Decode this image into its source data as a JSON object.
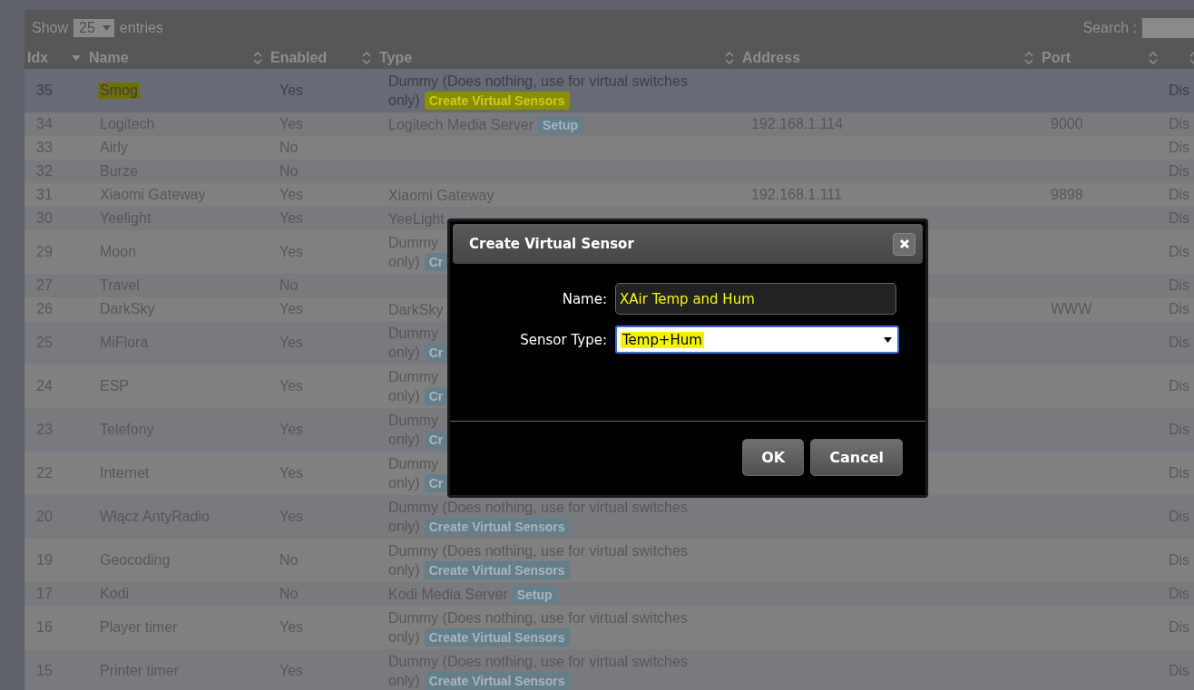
{
  "toolbar": {
    "show_label": "Show",
    "page_size": "25",
    "entries_label": "entries",
    "search_label": "Search :"
  },
  "table": {
    "columns": [
      {
        "label": "Idx",
        "kind": "sorted"
      },
      {
        "label": "Name",
        "kind": "sortable"
      },
      {
        "label": "Enabled",
        "kind": "sortable"
      },
      {
        "label": "Type",
        "kind": "sortable"
      },
      {
        "label": "Address",
        "kind": "sortable"
      },
      {
        "label": "Port",
        "kind": "sortable"
      },
      {
        "kind": "sortable"
      }
    ],
    "rows": [
      {
        "idx": "35",
        "name": "Smog",
        "enabled": "Yes",
        "type_lines": [
          "Dummy (Does nothing, use for virtual switches",
          "only)"
        ],
        "type_button": "Create Virtual Sensors",
        "column_7": "Dis",
        "selected": true,
        "highlighted": true
      },
      {
        "idx": "34",
        "name": "Logitech",
        "enabled": "Yes",
        "type_lines": [
          "Logitech Media Server"
        ],
        "type_button": "Setup",
        "address": "192.168.1.114",
        "port": "9000",
        "column_7": "Dis",
        "selected": false,
        "highlighted": false
      },
      {
        "idx": "33",
        "name": "Airly",
        "enabled": "No",
        "column_7": "Dis",
        "selected": false,
        "highlighted": false
      },
      {
        "idx": "32",
        "name": "Burze",
        "enabled": "No",
        "column_7": "Dis",
        "selected": false,
        "highlighted": false
      },
      {
        "idx": "31",
        "name": "Xiaomi Gateway",
        "enabled": "Yes",
        "type_lines": [
          "Xiaomi Gateway"
        ],
        "address": "192.168.1.111",
        "port": "9898",
        "column_7": "Dis",
        "selected": false,
        "highlighted": false
      },
      {
        "idx": "30",
        "name": "Yeelight",
        "enabled": "Yes",
        "type_lines": [
          "YeeLight"
        ],
        "column_7": "Dis",
        "selected": false,
        "highlighted": false
      },
      {
        "idx": "29",
        "name": "Moon",
        "enabled": "Yes",
        "type_lines": [
          "Dummy",
          "only)"
        ],
        "type_button": "Cr",
        "column_7": "Dis",
        "selected": false,
        "highlighted": false
      },
      {
        "idx": "27",
        "name": "Travel",
        "enabled": "No",
        "column_7": "Dis",
        "selected": false,
        "highlighted": false
      },
      {
        "idx": "26",
        "name": "DarkSky",
        "enabled": "Yes",
        "type_lines": [
          "DarkSky"
        ],
        "port": "WWW",
        "column_7": "Dis",
        "selected": false,
        "highlighted": false
      },
      {
        "idx": "25",
        "name": "MiFlora",
        "enabled": "Yes",
        "type_lines": [
          "Dummy",
          "only)"
        ],
        "type_button": "Cr",
        "column_7": "Dis",
        "selected": false,
        "highlighted": false
      },
      {
        "idx": "24",
        "name": "ESP",
        "enabled": "Yes",
        "type_lines": [
          "Dummy",
          "only)"
        ],
        "type_button": "Cr",
        "column_7": "Dis",
        "selected": false,
        "highlighted": false
      },
      {
        "idx": "23",
        "name": "Telefony",
        "enabled": "Yes",
        "type_lines": [
          "Dummy",
          "only)"
        ],
        "type_button": "Cr",
        "column_7": "Dis",
        "selected": false,
        "highlighted": false
      },
      {
        "idx": "22",
        "name": "Internet",
        "enabled": "Yes",
        "type_lines": [
          "Dummy",
          "only)"
        ],
        "type_button": "Cr",
        "column_7": "Dis",
        "selected": false,
        "highlighted": false
      },
      {
        "idx": "20",
        "name": "Włącz AntyRadio",
        "enabled": "Yes",
        "type_lines": [
          "Dummy (Does nothing, use for virtual switches",
          "only)"
        ],
        "type_button": "Create Virtual Sensors",
        "column_7": "Dis",
        "selected": false,
        "highlighted": false
      },
      {
        "idx": "19",
        "name": "Geocoding",
        "enabled": "No",
        "type_lines": [
          "Dummy (Does nothing, use for virtual switches",
          "only)"
        ],
        "type_button": "Create Virtual Sensors",
        "column_7": "Dis",
        "selected": false,
        "highlighted": false
      },
      {
        "idx": "17",
        "name": "Kodi",
        "enabled": "No",
        "type_lines": [
          "Kodi Media Server"
        ],
        "type_button": "Setup",
        "column_7": "Dis",
        "selected": false,
        "highlighted": false
      },
      {
        "idx": "16",
        "name": "Player timer",
        "enabled": "Yes",
        "type_lines": [
          "Dummy (Does nothing, use for virtual switches",
          "only)"
        ],
        "type_button": "Create Virtual Sensors",
        "column_7": "Dis",
        "selected": false,
        "highlighted": false
      },
      {
        "idx": "15",
        "name": "Printer timer",
        "enabled": "Yes",
        "type_lines": [
          "Dummy (Does nothing, use for virtual switches",
          "only)"
        ],
        "type_button": "Create Virtual Sensors",
        "column_7": "Dis",
        "selected": false,
        "highlighted": false
      }
    ]
  },
  "dialog": {
    "title": "Create Virtual Sensor",
    "fields": [
      {
        "kind": "text",
        "label": "Name:",
        "value": "XAir Temp and Hum",
        "highlighted": true
      },
      {
        "kind": "select",
        "label": "Sensor Type:",
        "value": "Temp+Hum",
        "highlighted": true
      }
    ],
    "buttons": [
      "OK",
      "Cancel"
    ]
  }
}
